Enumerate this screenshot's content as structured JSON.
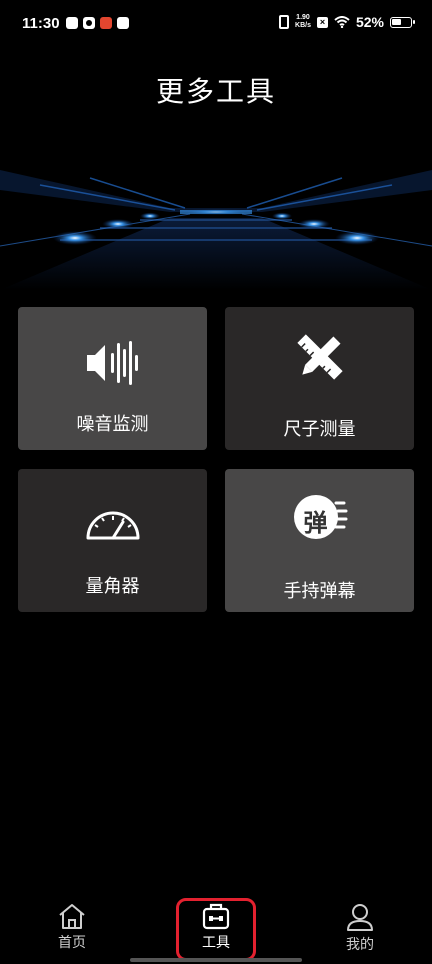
{
  "status_bar": {
    "time": "11:30",
    "net_speed_value": "1.90",
    "net_speed_unit": "KB/s",
    "battery_percent": "52%",
    "battery_level": 0.52
  },
  "header": {
    "title": "更多工具"
  },
  "tools": [
    {
      "label": "噪音监测",
      "icon": "noise-waveform-icon"
    },
    {
      "label": "尺子测量",
      "icon": "ruler-pencil-icon"
    },
    {
      "label": "量角器",
      "icon": "protractor-icon"
    },
    {
      "label": "手持弹幕",
      "icon": "bullet-screen-icon",
      "icon_text": "弹"
    }
  ],
  "bottom_nav": {
    "items": [
      {
        "label": "首页",
        "icon": "home-icon"
      },
      {
        "label": "工具",
        "icon": "toolbox-icon",
        "active": true
      },
      {
        "label": "我的",
        "icon": "user-icon"
      }
    ]
  },
  "colors": {
    "background": "#000000",
    "tile_dark": "#2a2828",
    "tile_light": "#484747",
    "highlight": "#e3212f",
    "banner_glow": "#3da2ff"
  }
}
